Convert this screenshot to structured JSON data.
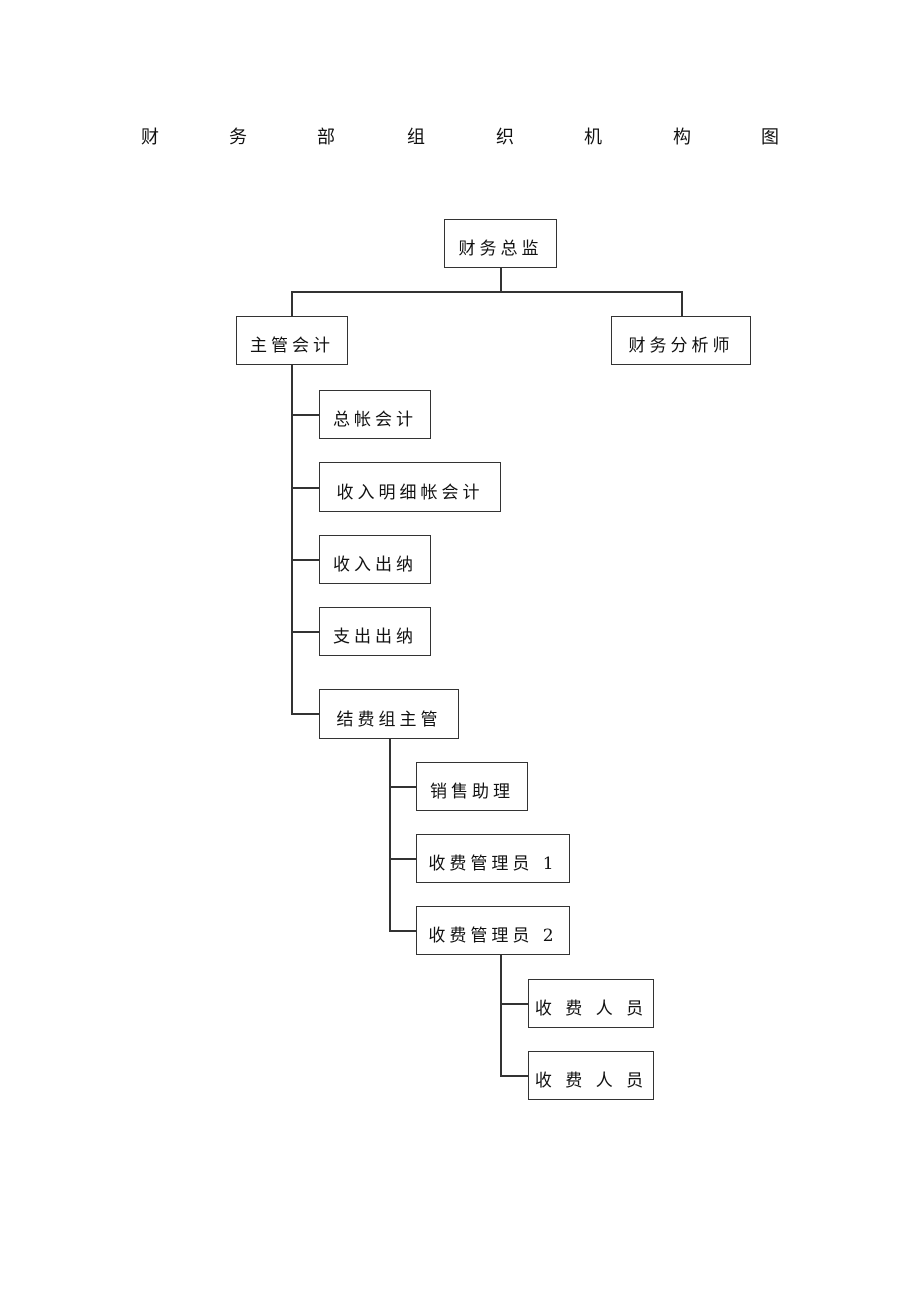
{
  "title": {
    "text": "财务部组织机构图",
    "chars": [
      "财",
      "务",
      "部",
      "组",
      "织",
      "机",
      "构",
      "图"
    ]
  },
  "nodes": {
    "cfo": "财务总监",
    "chief_accountant": "主管会计",
    "financial_analyst": "财务分析师",
    "general_ledger_accountant": "总帐会计",
    "income_detail_accountant": "收入明细帐会计",
    "income_cashier": "收入出纳",
    "expense_cashier": "支出出纳",
    "billing_group_supervisor": "结费组主管",
    "sales_assistant": "销售助理",
    "fee_administrator_1": "收费管理员 1",
    "fee_administrator_2": "收费管理员 2",
    "fee_collector_1": "收 费 人 员",
    "fee_collector_2": "收 费 人 员"
  },
  "hierarchy": {
    "财务总监": [
      "主管会计",
      "财务分析师"
    ],
    "主管会计": [
      "总帐会计",
      "收入明细帐会计",
      "收入出纳",
      "支出出纳",
      "结费组主管"
    ],
    "结费组主管": [
      "销售助理",
      "收费管理员 1",
      "收费管理员 2"
    ],
    "收费管理员 2": [
      "收费人员",
      "收费人员"
    ]
  }
}
